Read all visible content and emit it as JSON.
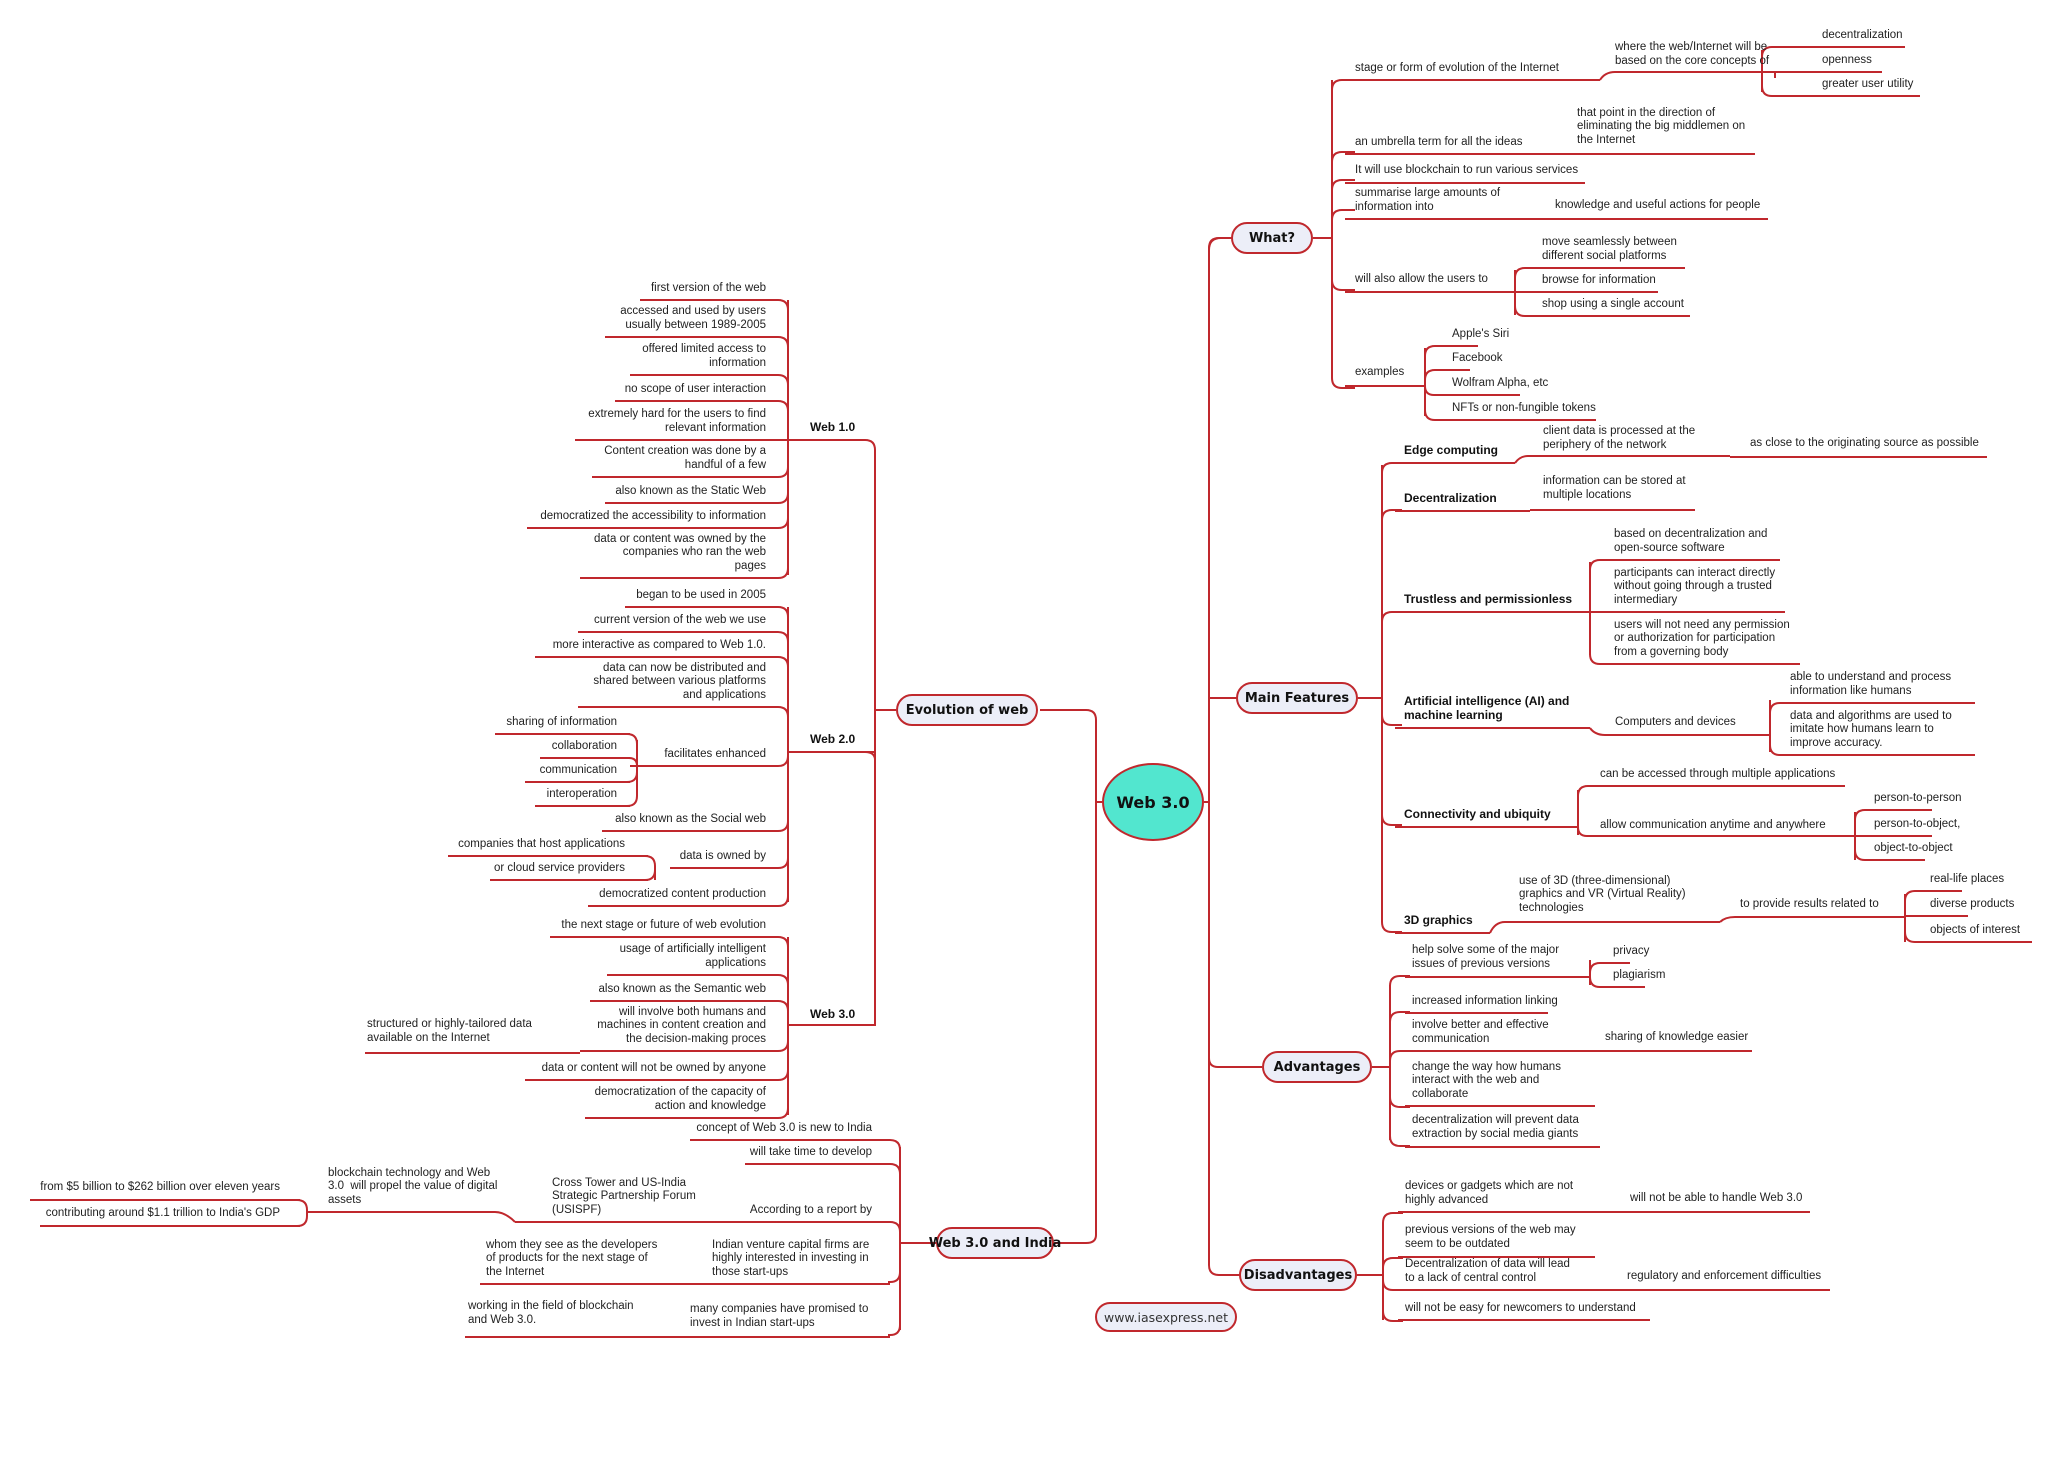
{
  "colors": {
    "line": "#c0282d",
    "central_fill": "#52e6cf",
    "node_fill": "#eceef8",
    "text": "#222222"
  },
  "central": "Web 3.0",
  "watermark": "www.iasexpress.net",
  "branches": {
    "what": {
      "title": "What?",
      "items": [
        {
          "text": "stage or form of evolution of the Internet",
          "child": {
            "text": "where the web/Internet will be\nbased on the core concepts of",
            "children": [
              "decentralization",
              "openness",
              "greater user utility"
            ]
          }
        },
        {
          "text": "an umbrella term for all the ideas",
          "child": {
            "text": "that point in the direction of\neliminating the big middlemen on\nthe Internet"
          }
        },
        {
          "text": "It will use blockchain to run various services"
        },
        {
          "text": "summarise large amounts of\ninformation into",
          "child": {
            "text": "knowledge and useful actions for people"
          }
        },
        {
          "text": "will also allow the users to",
          "children": [
            "move seamlessly between\ndifferent social platforms",
            "browse for information",
            "shop using a single account"
          ]
        },
        {
          "text": "examples",
          "children": [
            "Apple's Siri",
            "Facebook",
            "Wolfram Alpha, etc",
            "NFTs or non-fungible tokens"
          ]
        }
      ]
    },
    "features": {
      "title": "Main Features",
      "items": [
        {
          "text": "Edge computing",
          "child": {
            "text": "client data is processed at the\nperiphery of the network",
            "child": "as close to the originating source as possible"
          }
        },
        {
          "text": "Decentralization",
          "child": {
            "text": "information can be stored at\nmultiple locations"
          }
        },
        {
          "text": "Trustless and permissionless",
          "children": [
            "based on decentralization and\nopen-source software",
            "participants can interact directly\nwithout going through a trusted\nintermediary",
            "users will not need any permission\nor authorization for participation\nfrom a governing body"
          ]
        },
        {
          "text": "Artificial intelligence (AI) and\nmachine learning",
          "child": {
            "text": "Computers and devices",
            "children": [
              "able to understand and process\ninformation like humans",
              "data and algorithms are used to\nimitate how humans learn to\nimprove accuracy."
            ]
          }
        },
        {
          "text": "Connectivity and ubiquity",
          "children": [
            "can be accessed through multiple applications",
            "allow communication anytime and anywhere"
          ],
          "sub_children": [
            "person-to-person",
            "person-to-object,",
            "object-to-object"
          ]
        },
        {
          "text": "3D graphics",
          "child": {
            "text": "use of 3D (three-dimensional)\ngraphics and VR (Virtual Reality)\ntechnologies",
            "child": {
              "text": "to provide results related to",
              "children": [
                "real-life places",
                "diverse products",
                "objects of interest"
              ]
            }
          }
        }
      ]
    },
    "advantages": {
      "title": "Advantages",
      "items": [
        {
          "text": "help solve some of the major\nissues of previous versions",
          "children": [
            "privacy",
            "plagiarism"
          ]
        },
        {
          "text": "increased information linking"
        },
        {
          "text": "involve better and effective\ncommunication",
          "child": {
            "text": "sharing of knowledge easier"
          }
        },
        {
          "text": "change the way how humans\ninteract with the web and\ncollaborate"
        },
        {
          "text": "decentralization will prevent data\nextraction by social media giants"
        }
      ]
    },
    "disadvantages": {
      "title": "Disadvantages",
      "items": [
        {
          "text": "devices or gadgets which are not\nhighly advanced",
          "child": {
            "text": "will not be able to handle Web 3.0"
          }
        },
        {
          "text": "previous versions of the web may\nseem to be outdated"
        },
        {
          "text": "Decentralization of data will lead\nto a lack of central control",
          "child": {
            "text": "regulatory and enforcement difficulties"
          }
        },
        {
          "text": "will not be easy for newcomers to understand"
        }
      ]
    },
    "evolution": {
      "title": "Evolution of web",
      "web1": {
        "title": "Web 1.0",
        "items": [
          "first version of the web",
          "accessed and used by users\nusually between 1989-2005",
          "offered limited access to\ninformation",
          "no scope of user interaction",
          "extremely hard for the users to find\nrelevant information",
          "Content creation was done by a\nhandful of a few",
          "also known as the Static Web",
          "democratized the accessibility to information",
          "data or content was owned by the\ncompanies who ran the web\npages"
        ]
      },
      "web2": {
        "title": "Web 2.0",
        "items": [
          "began to be used in 2005",
          "current version of the web we use",
          "more interactive as compared to Web 1.0.",
          "data can now be distributed and\nshared between various platforms\nand applications",
          "facilitates enhanced",
          "also known as the Social web",
          "data is owned by",
          "democratized content production"
        ],
        "facilitates_children": [
          "sharing of information",
          "collaboration",
          "communication",
          "interoperation"
        ],
        "owned_by_children": [
          "companies that host applications",
          "or cloud service providers"
        ]
      },
      "web3": {
        "title": "Web 3.0",
        "items": [
          "the next stage or future of web evolution",
          "usage of artificially intelligent\napplications",
          "also known as the Semantic web",
          "will involve both humans and\nmachines in content creation and\nthe decision-making proces",
          "data or content will not be owned by anyone",
          "democratization of the capacity of\naction and knowledge"
        ],
        "involve_child": "structured or highly-tailored data\navailable on the Internet"
      }
    },
    "india": {
      "title": "Web 3.0 and India",
      "items": [
        {
          "text": "concept of Web 3.0 is new to India"
        },
        {
          "text": "will take time to develop"
        },
        {
          "text": "According to a report by",
          "child": {
            "text": "Cross Tower and US-India\nStrategic Partnership Forum\n(USISPF)",
            "child": {
              "text": "blockchain technology and Web\n3.0  will propel the value of digital\nassets",
              "children": [
                "from $5 billion to $262 billion over eleven years",
                "contributing around $1.1 trillion to India's GDP"
              ]
            }
          }
        },
        {
          "text": "Indian venture capital firms are\nhighly interested in investing in\nthose start-ups",
          "child": {
            "text": "whom they see as the developers\nof products for the next stage of\nthe Internet"
          }
        },
        {
          "text": "many companies have promised to\ninvest in Indian start-ups",
          "child": {
            "text": "working in the field of blockchain\nand Web 3.0."
          }
        }
      ]
    }
  }
}
